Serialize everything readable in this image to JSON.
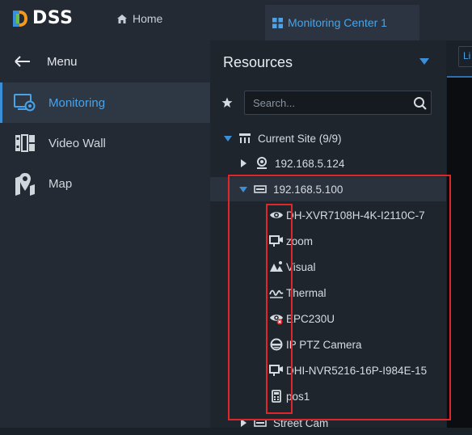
{
  "app": {
    "logo_text": "DSS"
  },
  "tabs": {
    "home": "Home",
    "monitoring": "Monitoring Center 1"
  },
  "nav": {
    "menu_label": "Menu",
    "items": [
      {
        "label": "Monitoring",
        "icon": "monitoring-icon",
        "active": true
      },
      {
        "label": "Video Wall",
        "icon": "video-wall-icon",
        "active": false
      },
      {
        "label": "Map",
        "icon": "map-icon",
        "active": false
      }
    ]
  },
  "resources": {
    "title": "Resources",
    "search_placeholder": "Search...",
    "tree": {
      "site": "Current Site (9/9)",
      "device1": "192.168.5.124",
      "device2": "192.168.5.100",
      "channels": [
        {
          "label": "DH-XVR7108H-4K-I2110C-7",
          "icon": "eye-camera-icon"
        },
        {
          "label": "zoom",
          "icon": "camera-icon"
        },
        {
          "label": "Visual",
          "icon": "visual-icon"
        },
        {
          "label": "Thermal",
          "icon": "thermal-icon"
        },
        {
          "label": "EPC230U",
          "icon": "eye-camera-alert-icon"
        },
        {
          "label": "IP PTZ Camera",
          "icon": "ptz-dome-icon"
        },
        {
          "label": "DHI-NVR5216-16P-I984E-15",
          "icon": "camera-icon"
        },
        {
          "label": "pos1",
          "icon": "pos-terminal-icon"
        }
      ],
      "next_device": "Street Cam"
    }
  },
  "right_panel": {
    "tab_label": "Li"
  },
  "colors": {
    "accent": "#4aa3e8",
    "highlight": "#e0262a",
    "panel": "#232a33"
  }
}
